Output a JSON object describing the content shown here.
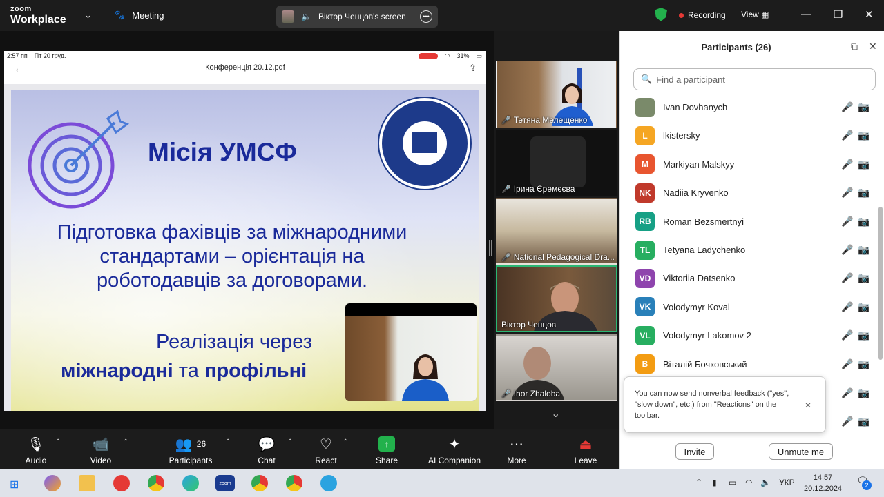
{
  "window": {
    "brand_top": "zoom",
    "brand_bottom": "Workplace",
    "meeting_label": "Meeting",
    "screen_label": "Віктор Ченцов's screen",
    "recording_label": "Recording",
    "view_label": "View"
  },
  "ipad": {
    "time": "2:57 пп",
    "date": "Пт 20 груд.",
    "battery": "31%",
    "pdf_title": "Конференція 20.12.pdf"
  },
  "slide": {
    "title": "Місія УМСФ",
    "body": "Підготовка фахівців за міжнародними стандартами – орієнтація на роботодавців за договорами.",
    "impl_line1": "Реалізація через",
    "impl_bold1": "міжнародні",
    "impl_mid": " та ",
    "impl_bold2": "профільні"
  },
  "gallery": [
    {
      "name": "Тетяна Мелещенко"
    },
    {
      "name": "Ірина Єремєєва"
    },
    {
      "name": "National Pedagogical Dra..."
    },
    {
      "name": "Віктор Ченцов"
    },
    {
      "name": "Ihor Zhaloba"
    }
  ],
  "toolbar": {
    "audio": "Audio",
    "video": "Video",
    "participants": "Participants",
    "participants_count": "26",
    "chat": "Chat",
    "react": "React",
    "share": "Share",
    "ai": "AI Companion",
    "more": "More",
    "leave": "Leave"
  },
  "panel": {
    "title": "Participants (26)",
    "search_placeholder": "Find a participant",
    "toast": "You can now send nonverbal feedback (\"yes\", \"slow down\", etc.) from \"Reactions\" on the toolbar.",
    "invite": "Invite",
    "unmute": "Unmute me",
    "participants": [
      {
        "initials": "",
        "name": "Ivan Dovhanych",
        "color": "#7a8a6a",
        "video_on": false
      },
      {
        "initials": "L",
        "name": "lkistersky",
        "color": "#f5a623",
        "video_on": false
      },
      {
        "initials": "M",
        "name": "Markiyan Malskyy",
        "color": "#e8552f",
        "video_on": false
      },
      {
        "initials": "NK",
        "name": "Nadiia Kryvenko",
        "color": "#c0392b",
        "video_on": false
      },
      {
        "initials": "RB",
        "name": "Roman Bezsmertnyi",
        "color": "#16a085",
        "video_on": true
      },
      {
        "initials": "TL",
        "name": "Tetyana Ladychenko",
        "color": "#27ae60",
        "video_on": false
      },
      {
        "initials": "VD",
        "name": "Viktoriia Datsenko",
        "color": "#8e44ad",
        "video_on": false
      },
      {
        "initials": "VK",
        "name": "Volodymyr Koval",
        "color": "#2980b9",
        "video_on": false
      },
      {
        "initials": "VL",
        "name": "Volodymyr Lakomov 2",
        "color": "#27ae60",
        "video_on": false
      },
      {
        "initials": "В",
        "name": "Віталій Бочковський",
        "color": "#f39c12",
        "video_on": false
      }
    ]
  },
  "taskbar": {
    "lang": "УКР",
    "time": "14:57",
    "date": "20.12.2024",
    "notif_count": "2"
  }
}
